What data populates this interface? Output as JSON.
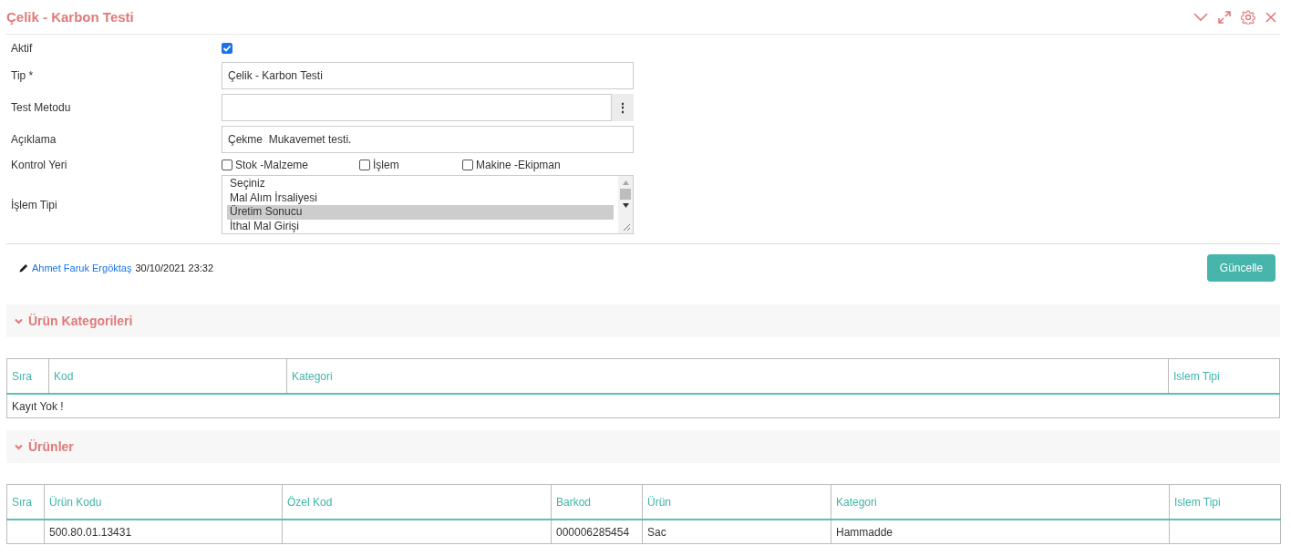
{
  "window": {
    "title": "Çelik - Karbon Testi"
  },
  "form": {
    "active": {
      "label": "Aktif",
      "checked": true
    },
    "tip": {
      "label": "Tip *",
      "value": "Çelik - Karbon Testi"
    },
    "test_metodu": {
      "label": "Test Metodu",
      "menu_glyph": "⋮"
    },
    "aciklama": {
      "label": "Açıklama",
      "value": "Çekme  Mukavemet testi."
    },
    "kontrol_yeri": {
      "label": "Kontrol Yeri",
      "options": [
        {
          "label": "Stok -Malzeme",
          "checked": false
        },
        {
          "label": "İşlem",
          "checked": false
        },
        {
          "label": "Makine -Ekipman",
          "checked": false
        }
      ]
    },
    "islem_tipi": {
      "label": "İşlem Tipi",
      "options": [
        {
          "label": "Seçiniz",
          "selected": false
        },
        {
          "label": "Mal Alım İrsaliyesi",
          "selected": false
        },
        {
          "label": "Üretim Sonucu",
          "selected": true
        },
        {
          "label": "İthal Mal Girişi",
          "selected": false
        }
      ]
    }
  },
  "audit": {
    "user": "Ahmet Faruk Ergöktaş",
    "timestamp": "30/10/2021 23:32"
  },
  "update_button": "Güncelle",
  "sections": [
    {
      "title": "Ürün Kategorileri",
      "expanded": true,
      "columns": [
        "Sıra",
        "Kod",
        "Kategori",
        "Islem Tipi"
      ],
      "empty_text": "Kayıt Yok !"
    },
    {
      "title": "Ürünler",
      "expanded": true,
      "columns": [
        "Sıra",
        "Ürün Kodu",
        "Özel Kod",
        "Barkod",
        "Ürün",
        "Kategori",
        "Islem Tipi"
      ],
      "rows": [
        [
          "",
          "500.80.01.13431",
          "",
          "000006285454",
          "Sac",
          "Hammadde",
          ""
        ]
      ]
    }
  ]
}
